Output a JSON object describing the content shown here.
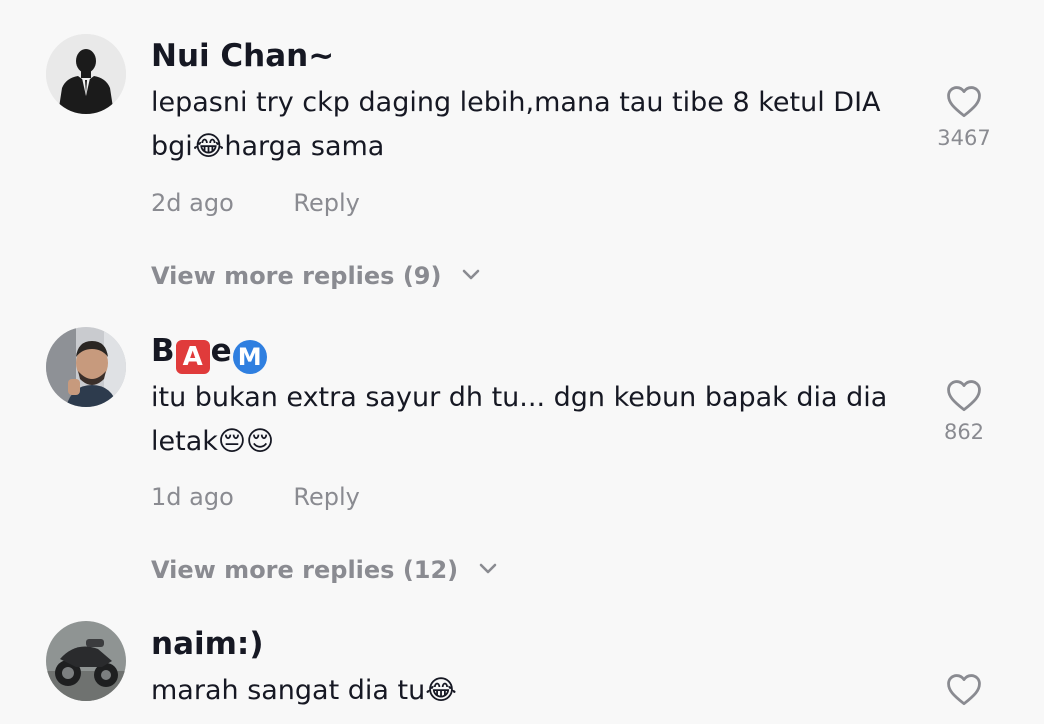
{
  "comments": [
    {
      "username": "Nui Chan~",
      "text_line1": "lepasni try ckp daging lebih,mana tau tibe 8 ketul DIA",
      "text_line2": "bgi😂harga sama",
      "likes": "3467",
      "time": "2d ago",
      "reply_label": "Reply",
      "more_replies": "View more replies (9)",
      "avatar": "suit-silhouette"
    },
    {
      "username_parts": [
        "B",
        "A",
        "e",
        "M"
      ],
      "text_line1": "itu bukan extra sayur dh tu... dgn kebun bapak dia dia",
      "text_line2": "letak😔😌",
      "likes": "862",
      "time": "1d ago",
      "reply_label": "Reply",
      "more_replies": "View more replies (12)",
      "avatar": "man-photo"
    },
    {
      "username": "naim:)",
      "text_line1": "marah sangat dia tu😂",
      "avatar": "motorcycle-photo"
    }
  ],
  "icons": {
    "like": "heart-outline-icon",
    "expand": "chevron-down-icon"
  },
  "colors": {
    "background": "#f8f8f8",
    "primary_text": "#161823",
    "secondary_text": "#8a8b91",
    "emoji_box_red": "#e03b3b",
    "emoji_circle_blue": "#2f7fe0"
  }
}
